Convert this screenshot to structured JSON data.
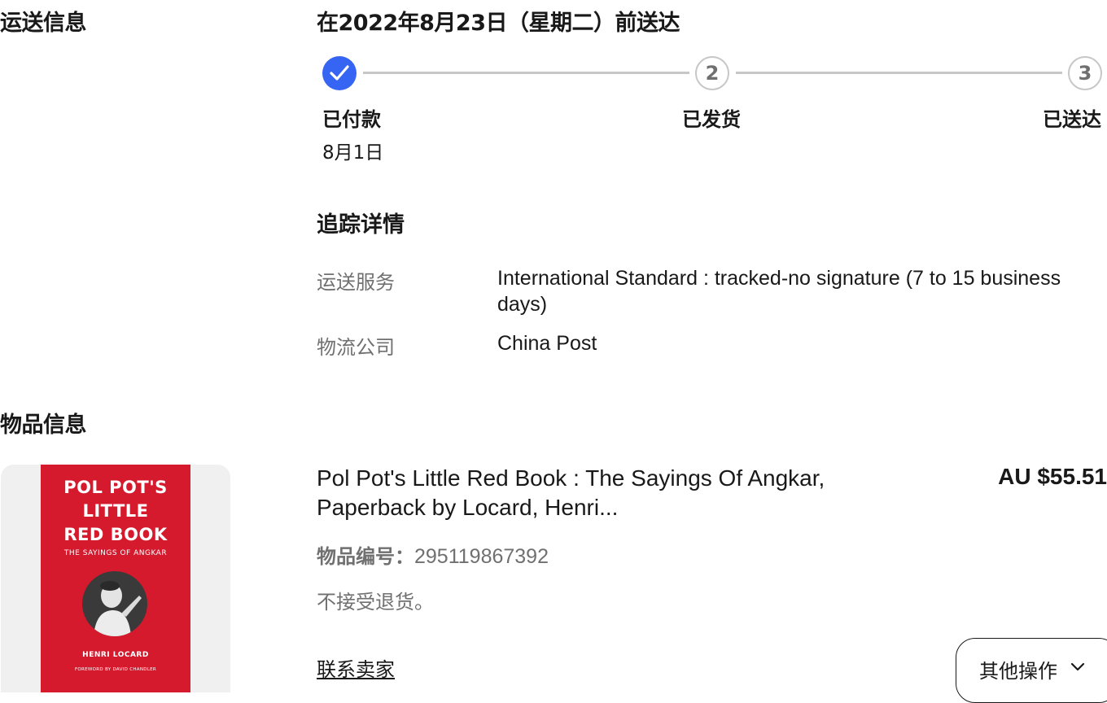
{
  "shipping": {
    "section_title": "运送信息",
    "delivery_estimate": "在2022年8月23日（星期二）前送达",
    "steps": [
      {
        "label": "已付款",
        "date": "8月1日",
        "status": "done"
      },
      {
        "number": "2",
        "label": "已发货",
        "status": "pending"
      },
      {
        "number": "3",
        "label": "已送达",
        "status": "pending"
      }
    ],
    "tracking_title": "追踪详情",
    "details": [
      {
        "label": "运送服务",
        "value": "International Standard : tracked-no signature (7 to 15 business days)"
      },
      {
        "label": "物流公司",
        "value": "China Post"
      }
    ]
  },
  "item": {
    "section_title": "物品信息",
    "title": "Pol Pot's Little Red Book : The Sayings Of Angkar, Paperback by Locard, Henri...",
    "price": "AU $55.51",
    "number_label": "物品编号：",
    "number": "295119867392",
    "return_policy": "不接受退货。",
    "contact_seller": "联系卖家",
    "more_actions": "其他操作",
    "cover": {
      "title_line1": "POL POT'S",
      "title_line2": "LITTLE",
      "title_line3": "RED BOOK",
      "subtitle": "THE SAYINGS OF ANGKAR",
      "author": "HENRI LOCARD",
      "foreword": "FOREWORD BY DAVID CHANDLER"
    }
  },
  "colors": {
    "accent": "#3665f3",
    "track": "#c7c7c7",
    "muted_text": "#707070",
    "text": "#191919",
    "cover_red": "#d51a2e"
  }
}
